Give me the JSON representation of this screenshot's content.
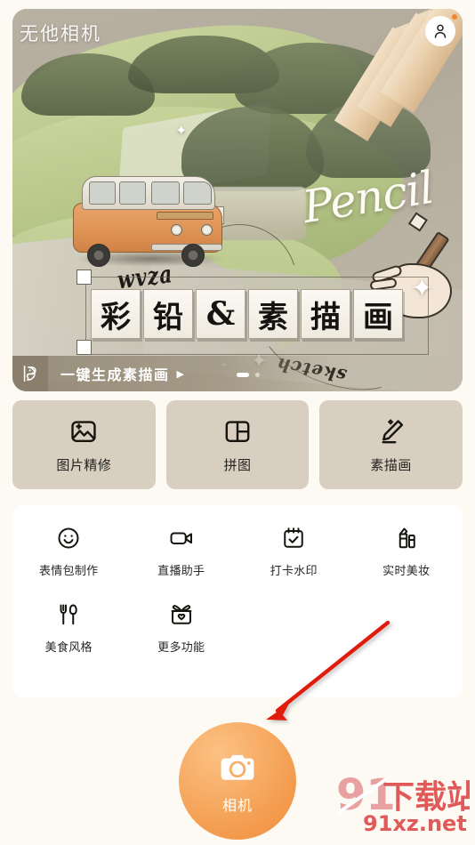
{
  "header": {
    "app_title": "无他相机",
    "avatar_icon": "user-avatar-icon",
    "notification_dot_color": "#f5842c"
  },
  "banner": {
    "headline_tiles": [
      "彩",
      "铅",
      "&",
      "素",
      "描",
      "画"
    ],
    "script_word": "Pencil",
    "deco_word_top": "wvza",
    "deco_word_bottom": "sketch",
    "cta_label": "一键生成素描画",
    "cta_caret": "▶",
    "cta_badge_icon": "palette-icon",
    "pagination": {
      "total": 2,
      "active_index": 0
    }
  },
  "feature_cards": [
    {
      "label": "图片精修",
      "icon": "image-sparkle-icon"
    },
    {
      "label": "拼图",
      "icon": "collage-grid-icon"
    },
    {
      "label": "素描画",
      "icon": "pencil-sketch-icon"
    }
  ],
  "tool_grid": [
    {
      "label": "表情包制作",
      "icon": "smiley-face-icon"
    },
    {
      "label": "直播助手",
      "icon": "video-camera-icon"
    },
    {
      "label": "打卡水印",
      "icon": "calendar-check-icon"
    },
    {
      "label": "实时美妆",
      "icon": "lipstick-icon"
    },
    {
      "label": "美食风格",
      "icon": "fork-spoon-icon"
    },
    {
      "label": "更多功能",
      "icon": "gift-box-icon"
    }
  ],
  "camera_button": {
    "label": "相机",
    "icon": "camera-icon",
    "color_start": "#fbc183",
    "color_end": "#f09243"
  },
  "annotation": {
    "arrow_color": "#e01b0f",
    "target": "camera-button"
  },
  "watermark": {
    "primary_text": "下载站",
    "numeral": "91",
    "url_text": "91xz.net",
    "color": "#e05a5a"
  },
  "theme": {
    "page_background": "#fdfaf3",
    "card_background": "#d8cfc0",
    "panel_background": "#ffffff",
    "accent": "#f5a04f"
  }
}
